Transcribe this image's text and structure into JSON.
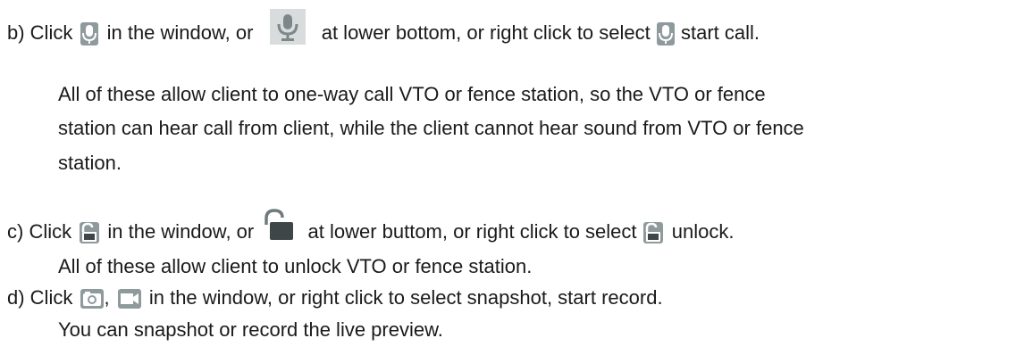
{
  "steps": {
    "b": {
      "prefix": "b) Click",
      "after_icon1": "in the window, or",
      "after_icon2": "at lower bottom, or right click to select",
      "after_icon3": "start call.",
      "note_lines": [
        "All of these allow client to one-way call VTO or fence station, so the VTO or fence",
        "station can hear call from client, while the client cannot hear sound from VTO or fence",
        "station."
      ]
    },
    "c": {
      "prefix": "c) Click",
      "after_icon1": "in the window, or",
      "after_icon2": "at lower buttom, or right click to select",
      "after_icon3": "unlock.",
      "note": "All of these allow client to unlock VTO or fence station."
    },
    "d": {
      "prefix": "d) Click",
      "sep": ",",
      "after_icons": "in the window, or right click to select snapshot, start record.",
      "note": "You can snapshot or record the live preview."
    }
  },
  "icons": [
    "mic-icon",
    "mic-button-icon",
    "unlock-icon",
    "unlock-button-icon",
    "camera-icon",
    "record-icon"
  ],
  "colors": {
    "icon_bg": "#8f9a9c",
    "icon_glyph": "#ffffff",
    "button_bg": "#d9dcdc",
    "text": "#1a1a1a"
  }
}
